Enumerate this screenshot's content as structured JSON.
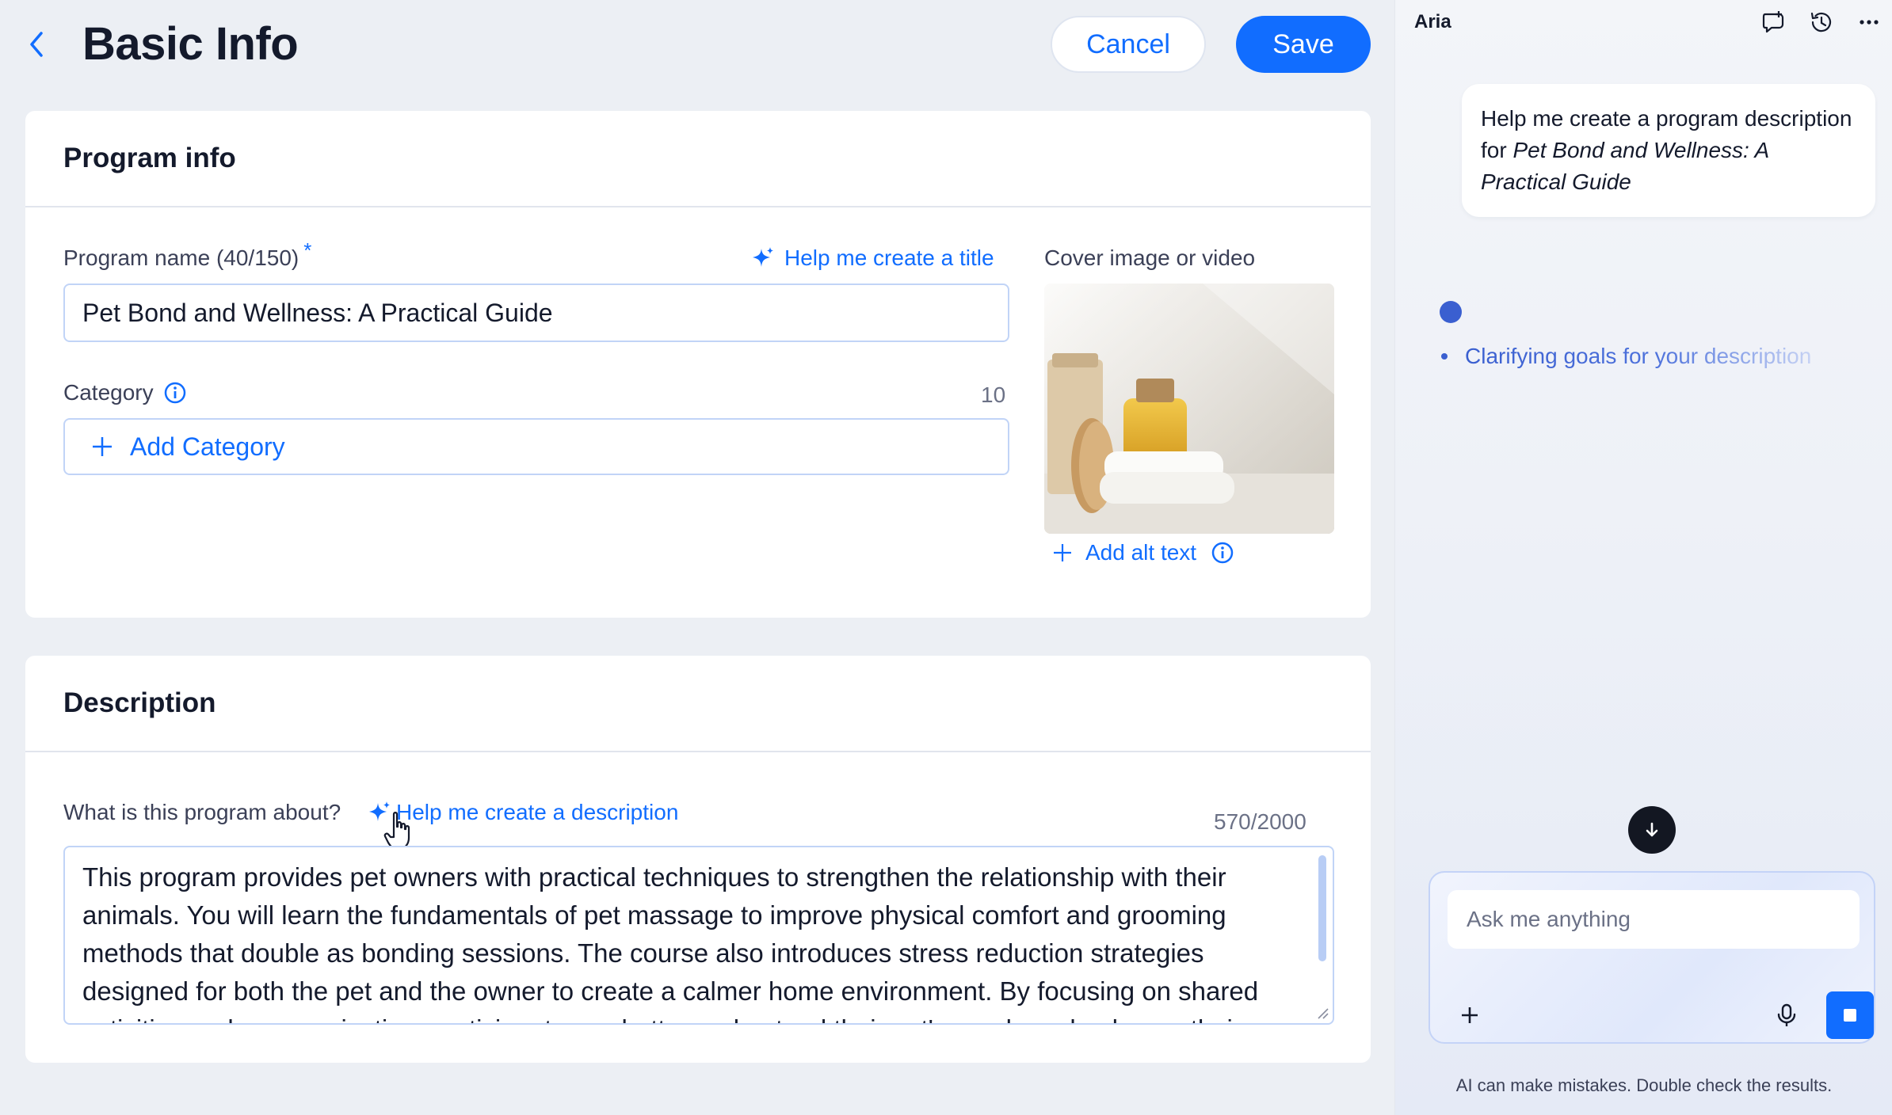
{
  "header": {
    "title": "Basic Info",
    "cancel_label": "Cancel",
    "save_label": "Save"
  },
  "program_info": {
    "title": "Program info",
    "name_label": "Program name (40/150)",
    "required_marker": "*",
    "help_title_label": "Help me create a title",
    "name_value": "Pet Bond and Wellness: A Practical Guide",
    "category_label": "Category",
    "category_count": "10",
    "add_category_label": "Add Category",
    "cover_label": "Cover image or video",
    "add_alt_text_label": "Add alt text"
  },
  "description": {
    "title": "Description",
    "question_label": "What is this program about?",
    "help_description_label": "Help me create a description",
    "char_count": "570/2000",
    "text": "This program provides pet owners with practical techniques to strengthen the relationship with their animals. You will learn the fundamentals of pet massage to improve physical comfort and grooming methods that double as bonding sessions. The course also introduces stress reduction strategies designed for both the pet and the owner to create a calmer home environment. By focusing on shared activities and communication, participants can better understand their pet's needs and enhance their"
  },
  "aria": {
    "title": "Aria",
    "user_message_plain": "Help me create a program description for ",
    "user_message_emphasis": "Pet Bond and Wellness: A Practical Guide",
    "status_text": "Clarifying goals for your description",
    "input_placeholder": "Ask me anything",
    "disclaimer": "AI can make mistakes. Double check the results."
  },
  "colors": {
    "accent": "#116dff",
    "background": "#eceff4",
    "text": "#141a2c",
    "aria_status": "#3a5fd0"
  },
  "icons": [
    "back-chevron-icon",
    "sparkle-icon",
    "info-icon",
    "plus-icon",
    "new-chat-icon",
    "history-icon",
    "more-icon",
    "arrow-down-icon",
    "microphone-icon",
    "stop-icon",
    "hand-cursor-icon"
  ]
}
